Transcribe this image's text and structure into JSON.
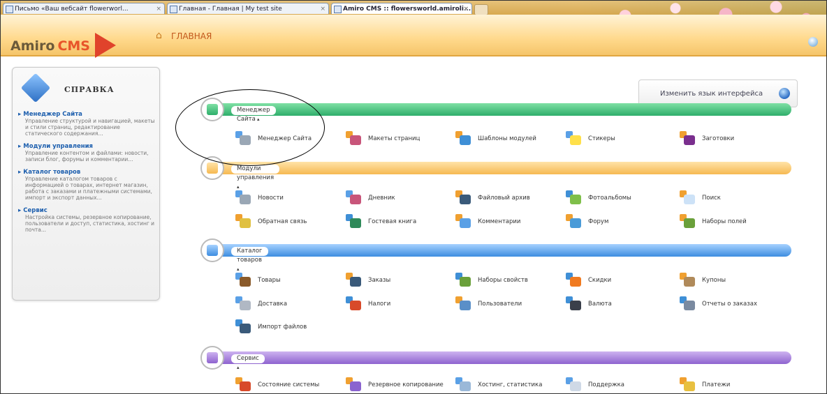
{
  "browser": {
    "tabs": [
      {
        "title": "Письмо «Ваш вебсайт flowerworl...",
        "active": false
      },
      {
        "title": "Главная - Главная | My test site",
        "active": false
      },
      {
        "title": "Amiro CMS :: flowersworld.amiroli...",
        "active": true
      }
    ],
    "new_tab_label": "+"
  },
  "header": {
    "logo_main": "Amiro",
    "logo_accent": "CMS",
    "page_title": "ГЛАВНАЯ",
    "home_icon": "home-icon",
    "help_icon": "help-circle-icon"
  },
  "help_panel": {
    "title": "СПРАВКА",
    "items": [
      {
        "title": "Менеджер Сайта",
        "text": "Управление структурой и навигацией, макеты и стили страниц, редактирование статического содержания..."
      },
      {
        "title": "Модули управления",
        "text": "Управление контентом и файлами: новости, записи блог, форумы и комментарии..."
      },
      {
        "title": "Каталог товаров",
        "text": "Управление каталогом товаров с информацией о товарах, интернет магазин, работа с заказами и платежными системами, импорт и экспорт данных..."
      },
      {
        "title": "Сервис",
        "text": "Настройка системы, резервное копирование, пользователи и доступ, статистика, хостинг и почта..."
      }
    ]
  },
  "language_button": {
    "label": "Изменить язык интерфейса"
  },
  "sections": [
    {
      "key": "site-manager",
      "label": "Менеджер Сайта",
      "color": "#2fae6b",
      "modules": [
        "Менеджер Сайта",
        "Макеты страниц",
        "Шаблоны модулей",
        "Стикеры",
        "Заготовки"
      ]
    },
    {
      "key": "control-modules",
      "label": "Модули управления",
      "color": "#f6b952",
      "modules": [
        "Новости",
        "Дневник",
        "Файловый архив",
        "Фотоальбомы",
        "Поиск",
        "Обратная связь",
        "Гостевая книга",
        "Комментарии",
        "Форум",
        "Наборы полей"
      ]
    },
    {
      "key": "catalog",
      "label": "Каталог товаров",
      "color": "#3d8de0",
      "modules": [
        "Товары",
        "Заказы",
        "Наборы свойств",
        "Скидки",
        "Купоны",
        "Доставка",
        "Налоги",
        "Пользователи",
        "Валюта",
        "Отчеты о заказах",
        "Импорт файлов"
      ]
    },
    {
      "key": "service",
      "label": "Сервис",
      "color": "#8e63cf",
      "modules": [
        "Состояние системы",
        "Резервное копирование",
        "Хостинг, статистика",
        "Поддержка",
        "Платежи"
      ]
    }
  ]
}
